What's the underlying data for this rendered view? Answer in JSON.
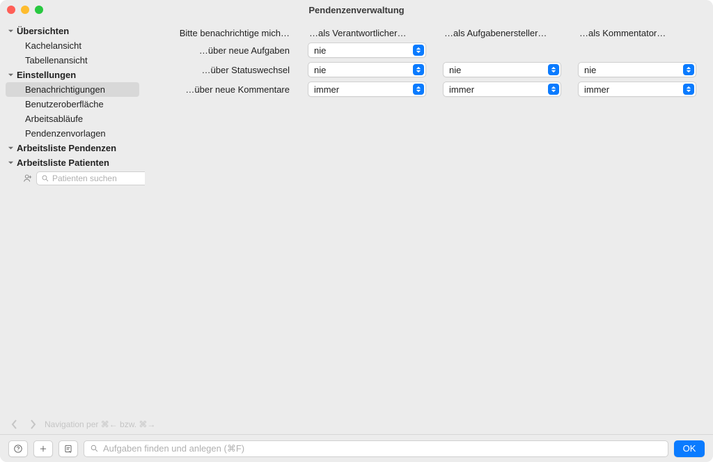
{
  "window": {
    "title": "Pendenzenverwaltung"
  },
  "sidebar": {
    "groups": [
      {
        "label": "Übersichten",
        "items": [
          {
            "label": "Kachelansicht",
            "selected": false
          },
          {
            "label": "Tabellenansicht",
            "selected": false
          }
        ]
      },
      {
        "label": "Einstellungen",
        "items": [
          {
            "label": "Benachrichtigungen",
            "selected": true
          },
          {
            "label": "Benutzeroberfläche",
            "selected": false
          },
          {
            "label": "Arbeitsabläufe",
            "selected": false
          },
          {
            "label": "Pendenzenvorlagen",
            "selected": false
          }
        ]
      },
      {
        "label": "Arbeitsliste Pendenzen",
        "items": []
      },
      {
        "label": "Arbeitsliste Patienten",
        "search_placeholder": "Patienten suchen",
        "items": []
      }
    ]
  },
  "content": {
    "row_labels": {
      "header": "Bitte benachrichtige mich…",
      "new_tasks": "…über neue Aufgaben",
      "status_change": "…über Statuswechsel",
      "new_comments": "…über neue Kommentare"
    },
    "columns": {
      "responsible": "…als Verantwortlicher…",
      "creator": "…als Aufgabenersteller…",
      "commenter": "…als Kommentator…"
    },
    "values": {
      "responsible": {
        "new_tasks": "nie",
        "status_change": "nie",
        "new_comments": "immer"
      },
      "creator": {
        "status_change": "nie",
        "new_comments": "immer"
      },
      "commenter": {
        "status_change": "nie",
        "new_comments": "immer"
      }
    }
  },
  "nav_hint": "Navigation per ⌘← bzw. ⌘→",
  "bottombar": {
    "search_placeholder": "Aufgaben finden und anlegen (⌘F)",
    "ok_label": "OK"
  }
}
